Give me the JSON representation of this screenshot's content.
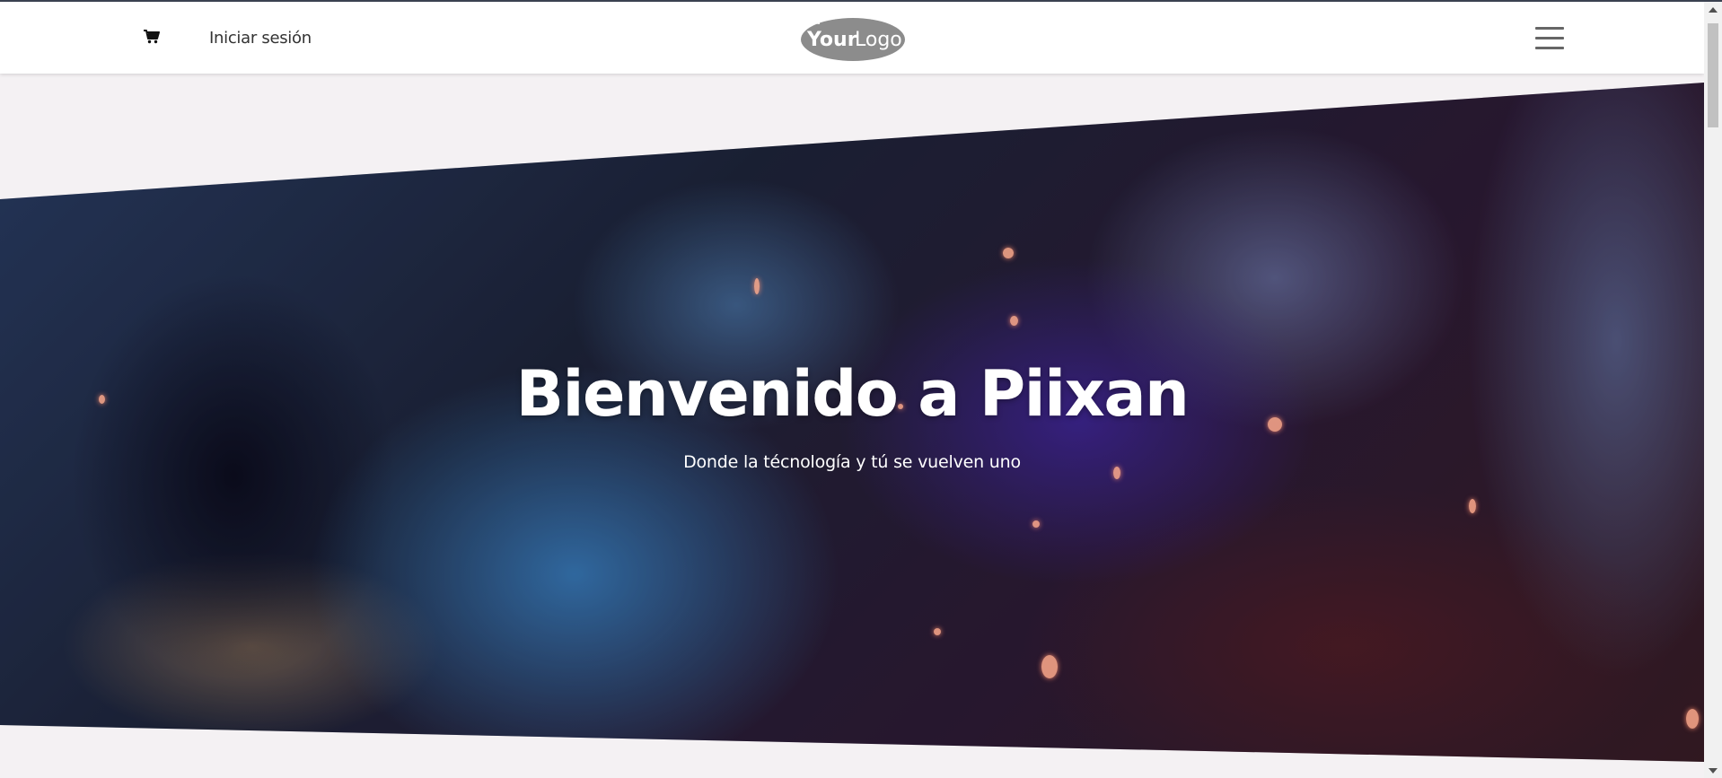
{
  "header": {
    "cart_icon": "shopping-cart-icon",
    "login_label": "Iniciar sesión",
    "logo": {
      "text_bold": "Your",
      "text_light": "Logo"
    },
    "menu_icon": "hamburger-menu-icon"
  },
  "hero": {
    "title": "Bienvenido a Piixan",
    "subtitle": "Donde la técnología y tú se vuelven uno"
  },
  "colors": {
    "header_bg": "#ffffff",
    "logo_ellipse": "#8c8c8c",
    "menu_lines": "#666666",
    "page_bg_below": "#f4f1f3",
    "hero_text": "#ffffff"
  }
}
